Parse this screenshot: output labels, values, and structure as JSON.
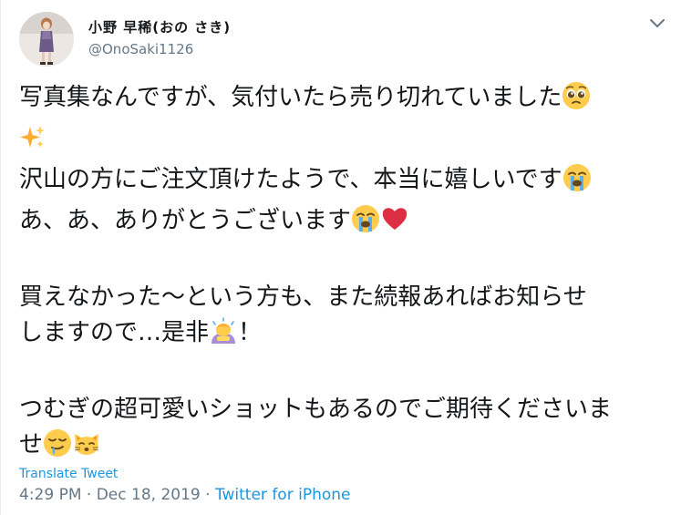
{
  "author": {
    "display_name": "小野 早稀(おの さき)",
    "handle": "@OnoSaki1126"
  },
  "tweet": {
    "line1": "写真集なんですが、気付いたら売り切れていました",
    "line3": "沢山の方にご注文頂けたようで、本当に嬉しいです",
    "line4": "あ、あ、ありがとうございます",
    "line5": "買えなかった～という方も、また続報あればお知らせ",
    "line6_a": "しますので…是非",
    "line6_b": "！",
    "line7": "つむぎの超可愛いショットもあるのでご期待くださいま",
    "line8": "せ"
  },
  "emoji": {
    "pleading": "pleading-face-emoji",
    "sparkles": "sparkles-emoji",
    "crying": "loudly-crying-face-emoji",
    "heart": "red-heart-emoji",
    "bowing": "person-bowing-emoji",
    "drooling": "drooling-face-emoji",
    "cat": "cat-face-emoji"
  },
  "translate_label": "Translate Tweet",
  "meta": {
    "time_date": "4:29 PM · Dec 18, 2019 · ",
    "source": "Twitter for iPhone"
  },
  "colors": {
    "link": "#1b95e0",
    "secondary": "#657786",
    "text": "#14171a"
  }
}
